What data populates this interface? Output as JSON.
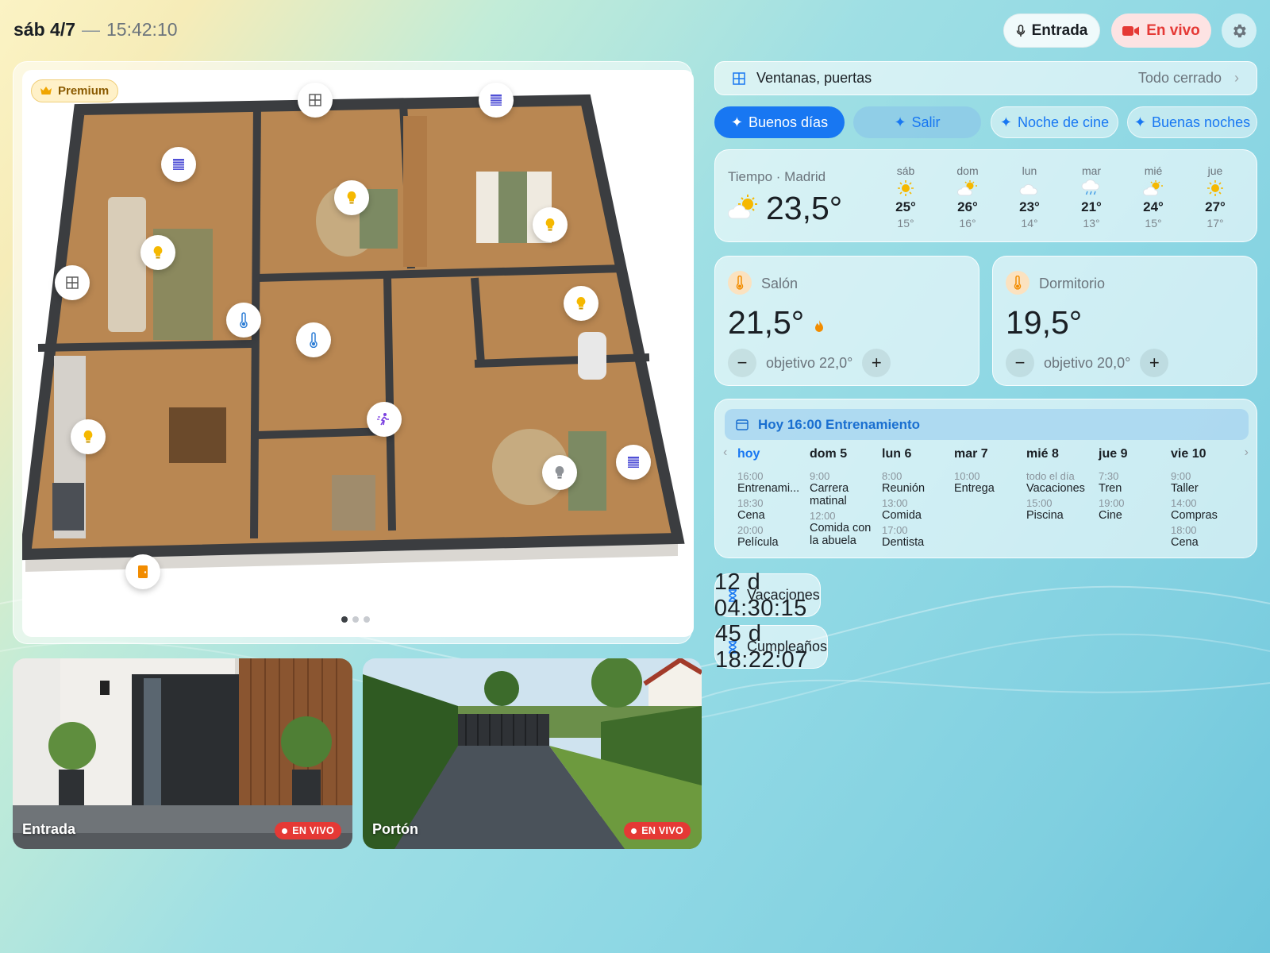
{
  "header": {
    "date": "sáb 4/7",
    "separator": "—",
    "time": "15:42:10"
  },
  "buttons": {
    "entrada": "Entrada",
    "live": "En vivo"
  },
  "floorplan": {
    "badge": "Premium",
    "page_count": 3,
    "current_page": 1
  },
  "security": {
    "label": "Ventanas, puertas",
    "status": "Todo cerrado"
  },
  "scenes": [
    {
      "label": "Buenos días"
    },
    {
      "label": "Salir"
    },
    {
      "label": "Noche de cine"
    },
    {
      "label": "Buenas noches"
    }
  ],
  "weather": {
    "title": "Tiempo · Madrid",
    "current": "23,5°",
    "forecast": [
      {
        "day": "sáb",
        "hi": "25°",
        "lo": "15°",
        "icon": "sun-icon"
      },
      {
        "day": "dom",
        "hi": "26°",
        "lo": "16°",
        "icon": "partly-cloudy-icon"
      },
      {
        "day": "lun",
        "hi": "23°",
        "lo": "14°",
        "icon": "cloud-icon"
      },
      {
        "day": "mar",
        "hi": "21°",
        "lo": "13°",
        "icon": "rain-icon"
      },
      {
        "day": "mié",
        "hi": "24°",
        "lo": "15°",
        "icon": "partly-cloudy-icon"
      },
      {
        "day": "jue",
        "hi": "27°",
        "lo": "17°",
        "icon": "sun-icon"
      }
    ]
  },
  "rooms": [
    {
      "name": "Salón",
      "temp": "21,5°",
      "target": "objetivo 22,0°",
      "heating": true
    },
    {
      "name": "Dormitorio",
      "temp": "19,5°",
      "target": "objetivo 20,0°",
      "heating": false
    }
  ],
  "calendar": {
    "headline": "Hoy 16:00 Entrenamiento",
    "days": [
      {
        "label": "hoy",
        "events": [
          {
            "time": "16:00",
            "title": "Entrenami..."
          },
          {
            "time": "18:30",
            "title": "Cena"
          },
          {
            "time": "20:00",
            "title": "Película"
          }
        ]
      },
      {
        "label": "dom 5",
        "events": [
          {
            "time": "9:00",
            "title": "Carrera matinal"
          },
          {
            "time": "12:00",
            "title": "Comida con la abuela"
          }
        ]
      },
      {
        "label": "lun 6",
        "events": [
          {
            "time": "8:00",
            "title": "Reunión"
          },
          {
            "time": "13:00",
            "title": "Comida"
          },
          {
            "time": "17:00",
            "title": "Dentista"
          }
        ]
      },
      {
        "label": "mar 7",
        "events": [
          {
            "time": "10:00",
            "title": "Entrega"
          }
        ]
      },
      {
        "label": "mié 8",
        "events": [
          {
            "time": "todo el día",
            "title": "Vacaciones"
          },
          {
            "time": "15:00",
            "title": "Piscina"
          }
        ]
      },
      {
        "label": "jue 9",
        "events": [
          {
            "time": "7:30",
            "title": "Tren"
          },
          {
            "time": "19:00",
            "title": "Cine"
          }
        ]
      },
      {
        "label": "vie 10",
        "events": [
          {
            "time": "9:00",
            "title": "Taller"
          },
          {
            "time": "14:00",
            "title": "Compras"
          },
          {
            "time": "18:00",
            "title": "Cena"
          }
        ]
      }
    ]
  },
  "countdowns": [
    {
      "label": "Vacaciones",
      "value": "12 d 04:30:15"
    },
    {
      "label": "Cumpleaños",
      "value": "45 d 18:22:07"
    }
  ],
  "cameras": [
    {
      "name": "Entrada",
      "status": "EN VIVO"
    },
    {
      "name": "Portón",
      "status": "EN VIVO"
    }
  ],
  "colors": {
    "accent": "#1877f2",
    "live": "#e53935",
    "light": "#f5b800",
    "thermo": "#2f7fd6",
    "motion": "#7a3fe0"
  }
}
